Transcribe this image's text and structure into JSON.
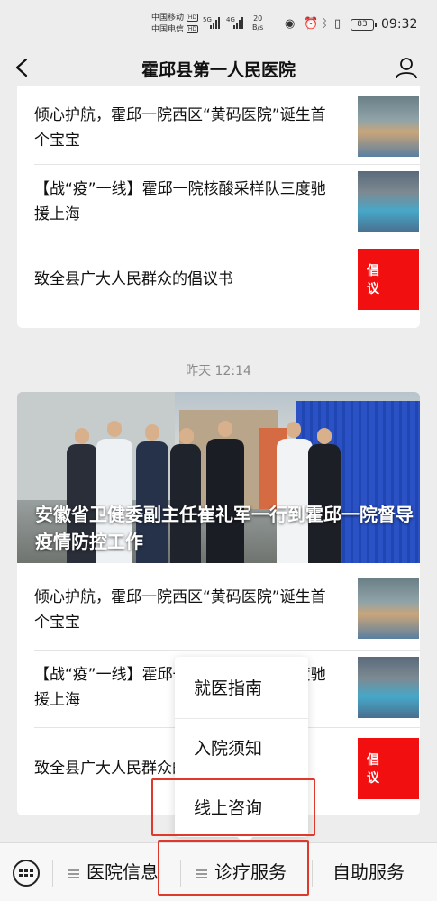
{
  "status_bar": {
    "carrier1": "中国移动",
    "carrier2": "中国电信",
    "hd": "HD",
    "sig1": "5G",
    "sig2": "4G",
    "speed_value": "20",
    "speed_unit": "B/s",
    "battery": "83",
    "time": "09:32"
  },
  "header": {
    "title": "霍邱县第一人民医院"
  },
  "top_card": {
    "items": [
      {
        "title": "倾心护航，霍邱一院西区“黄码医院”诞生首个宝宝"
      },
      {
        "title": "【战“疫”一线】霍邱一院核酸采样队三度驰援上海"
      },
      {
        "title": "致全县广大人民群众的倡议书",
        "thumb_text": "倡 议"
      }
    ]
  },
  "timestamp": "昨天 12:14",
  "main_card": {
    "hero_title": "安徽省卫健委副主任崔礼军一行到霍邱一院督导疫情防控工作",
    "items": [
      {
        "title": "倾心护航，霍邱一院西区“黄码医院”诞生首个宝宝"
      },
      {
        "title": "【战“疫”一线】霍邱一院核酸采样队三度驰援上海"
      },
      {
        "title": "致全县广大人民群众的倡议书",
        "thumb_text": "倡 议"
      }
    ]
  },
  "popup_menu": {
    "items": [
      "就医指南",
      "入院须知",
      "线上咨询"
    ]
  },
  "bottom_bar": {
    "tabs": [
      "医院信息",
      "诊疗服务",
      "自助服务"
    ]
  },
  "colors": {
    "accent_red": "#f20f0f",
    "highlight_red": "#e0392b",
    "background": "#ededed"
  }
}
